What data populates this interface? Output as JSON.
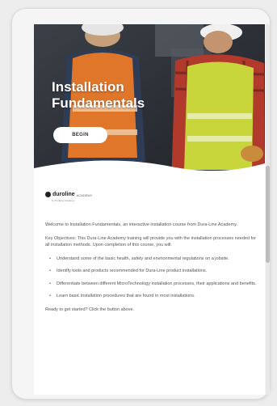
{
  "hero": {
    "title_line1": "Installation",
    "title_line2": "Fundamentals",
    "begin_label": "BEGIN"
  },
  "logo": {
    "brand": "duroline",
    "subtitle": "ACADEMY",
    "tagline": "by Duraline Academy"
  },
  "content": {
    "intro": "Welcome to Installation Fundamentals, an interactive installation course from Dura-Line Academy.",
    "objectives": "Key Objectives: This Dura-Line Academy training will provide you with the installation processes needed for all installation methods. Upon completion of this course, you will:",
    "bullets": [
      "Understand some of the basic health, safety and environmental regulations on a jobsite.",
      "Identify tools and products recommended for Dura-Line product installations.",
      "Differentiate between different MicroTechnology installation processes, their applications and benefits.",
      "Learn basic installation procedures that are found in most installations."
    ],
    "closing": "Ready to get started? Click the button above."
  },
  "colors": {
    "vest_orange": "#e0762a",
    "vest_yellow": "#c8d63c",
    "hero_dark": "#2c2f35"
  }
}
